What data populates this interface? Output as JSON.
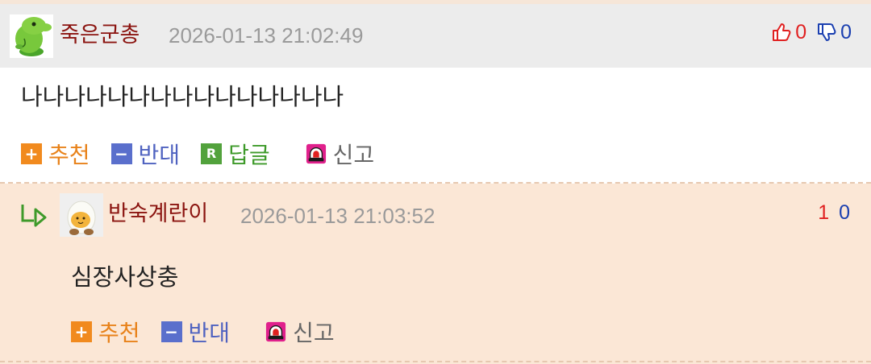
{
  "comment": {
    "author": "죽은군총",
    "timestamp": "2026-01-13 21:02:49",
    "upvotes": "0",
    "downvotes": "0",
    "body": "나나나나나나나나나나나나나나나",
    "actions": {
      "recommend": "추천",
      "oppose": "반대",
      "reply": "답글",
      "report": "신고"
    },
    "avatar_icon": "green-mascot-avatar"
  },
  "reply": {
    "author": "반숙계란이",
    "timestamp": "2026-01-13 21:03:52",
    "upvotes": "1",
    "downvotes": "0",
    "body": "심장사상충",
    "actions": {
      "recommend": "추천",
      "oppose": "반대",
      "report": "신고"
    },
    "avatar_icon": "egg-avatar"
  },
  "icons": {
    "recommend": "plus-icon",
    "oppose": "minus-icon",
    "reply": "reply-r-icon",
    "report": "siren-icon",
    "thumbs_up": "thumbs-up-icon",
    "thumbs_down": "thumbs-down-icon",
    "reply_indicator": "reply-arrow-icon"
  },
  "colors": {
    "author": "#8b1410",
    "recommend": "#f18a1e",
    "oppose": "#5a6fcc",
    "reply": "#52a23c",
    "upvote": "#e02020",
    "downvote": "#1a3fb0",
    "reply_background": "#fbe7d6",
    "header_background": "#ececec"
  }
}
